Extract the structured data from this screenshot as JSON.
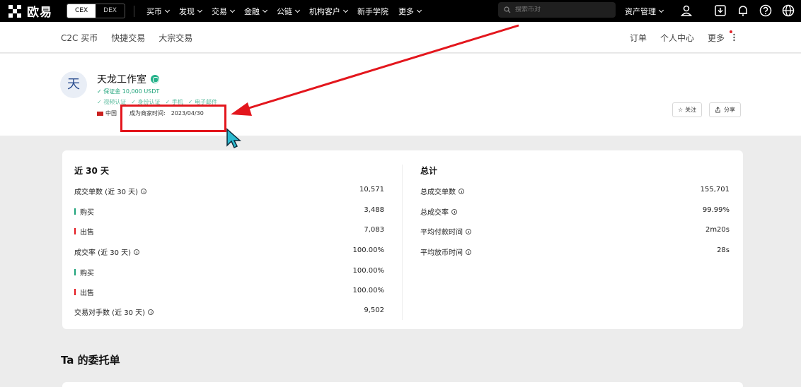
{
  "topbar": {
    "logo_text": "欧易",
    "toggle": [
      "CEX",
      "DEX"
    ],
    "nav": [
      {
        "label": "买币",
        "caret": true
      },
      {
        "label": "发现",
        "caret": true
      },
      {
        "label": "交易",
        "caret": true
      },
      {
        "label": "金融",
        "caret": true
      },
      {
        "label": "公链",
        "caret": true
      },
      {
        "label": "机构客户",
        "caret": true
      },
      {
        "label": "新手学院",
        "caret": false
      },
      {
        "label": "更多",
        "caret": true
      }
    ],
    "search_placeholder": "搜索币对",
    "asset_label": "资产管理",
    "icons": [
      "user-icon",
      "download-icon",
      "bell-icon",
      "help-icon",
      "globe-icon"
    ]
  },
  "subnav": {
    "left": [
      "C2C 买币",
      "快捷交易",
      "大宗交易"
    ],
    "right": [
      "订单",
      "个人中心",
      "更多"
    ]
  },
  "profile": {
    "avatar": "天",
    "name": "天龙工作室",
    "deposit": "✓ 保证金 10,000 USDT",
    "badges": [
      "✓ 视频认证",
      "✓ 身份认证",
      "✓ 手机",
      "✓ 电子邮件"
    ],
    "country": "中国",
    "since_label": "成为商家时间:",
    "since_value": "2023/04/30",
    "follow_label": "关注",
    "share_label": "分享"
  },
  "stats": {
    "left_title": "近 30 天",
    "left_rows": [
      {
        "label": "成交单数 (近 30 天)",
        "value": "10,571",
        "info": true,
        "bar": ""
      },
      {
        "label": "购买",
        "value": "3,488",
        "info": false,
        "bar": "green"
      },
      {
        "label": "出售",
        "value": "7,083",
        "info": false,
        "bar": "red"
      },
      {
        "label": "成交率 (近 30 天)",
        "value": "100.00%",
        "info": true,
        "bar": ""
      },
      {
        "label": "购买",
        "value": "100.00%",
        "info": false,
        "bar": "green"
      },
      {
        "label": "出售",
        "value": "100.00%",
        "info": false,
        "bar": "red"
      },
      {
        "label": "交易对手数 (近 30 天)",
        "value": "9,502",
        "info": true,
        "bar": ""
      }
    ],
    "right_title": "总计",
    "right_rows": [
      {
        "label": "总成交单数",
        "value": "155,701",
        "info": true
      },
      {
        "label": "总成交率",
        "value": "99.99%",
        "info": true
      },
      {
        "label": "平均付款时间",
        "value": "2m20s",
        "info": true
      },
      {
        "label": "平均放币时间",
        "value": "28s",
        "info": true
      }
    ]
  },
  "orders_title": "Ta 的委托单"
}
